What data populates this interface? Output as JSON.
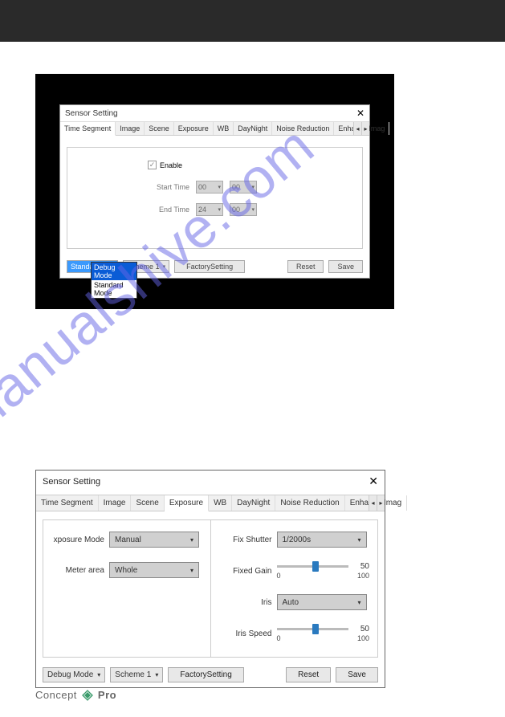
{
  "dialog1": {
    "title": "Sensor Setting",
    "tabs": [
      "Time Segment",
      "Image",
      "Scene",
      "Exposure",
      "WB",
      "DayNight",
      "Noise Reduction",
      "Enhance Imag"
    ],
    "active_tab": "Time Segment",
    "enable_label": "Enable",
    "enable_checked": true,
    "start_time_label": "Start Time",
    "start_h": "00",
    "start_m": "00",
    "end_time_label": "End Time",
    "end_h": "24",
    "end_m": "00",
    "mode_select": "Standard m",
    "scheme_select": "Scheme 1",
    "factory_btn": "FactorySetting",
    "reset_btn": "Reset",
    "save_btn": "Save",
    "dropdown": {
      "opt1": "Debug Mode",
      "opt2": "Standard Mode"
    }
  },
  "dialog2": {
    "title": "Sensor Setting",
    "tabs": [
      "Time Segment",
      "Image",
      "Scene",
      "Exposure",
      "WB",
      "DayNight",
      "Noise Reduction",
      "Enhance Imag"
    ],
    "active_tab": "Exposure",
    "exposure_mode_label": "xposure Mode",
    "exposure_mode_value": "Manual",
    "meter_area_label": "Meter area",
    "meter_area_value": "Whole",
    "fix_shutter_label": "Fix Shutter",
    "fix_shutter_value": "1/2000s",
    "fixed_gain_label": "Fixed Gain",
    "fixed_gain_value": "50",
    "gain_min": "0",
    "gain_max": "100",
    "iris_label": "Iris",
    "iris_value": "Auto",
    "iris_speed_label": "Iris Speed",
    "iris_speed_value": "50",
    "speed_min": "0",
    "speed_max": "100",
    "mode_select": "Debug Mode",
    "scheme_select": "Scheme 1",
    "factory_btn": "FactorySetting",
    "reset_btn": "Reset",
    "save_btn": "Save"
  },
  "watermark": "manualshive.com",
  "footer": {
    "brand1": "Concept",
    "brand2": "Pro"
  }
}
